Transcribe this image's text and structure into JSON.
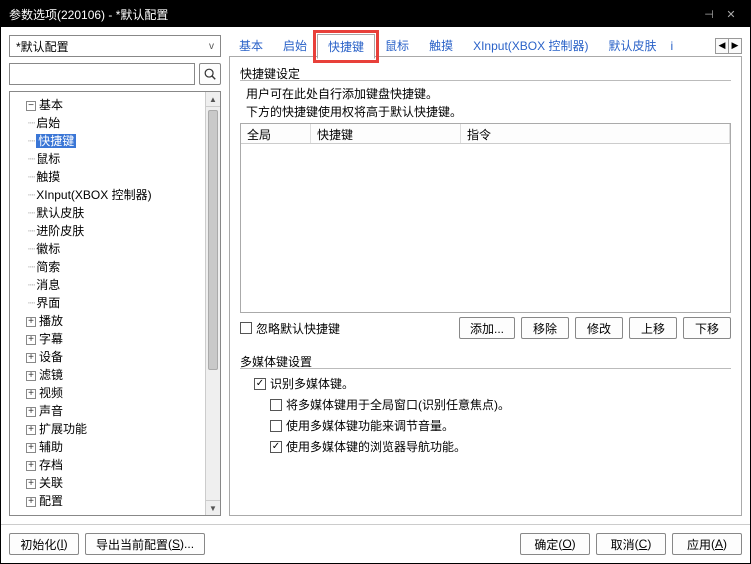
{
  "window": {
    "title": "参数选项(220106) - *默认配置"
  },
  "left": {
    "combo_value": "*默认配置"
  },
  "tree": {
    "root": "基本",
    "children": [
      "启始",
      "快捷键",
      "鼠标",
      "触摸",
      "XInput(XBOX 控制器)",
      "默认皮肤",
      "进阶皮肤",
      "徽标",
      "简索",
      "消息",
      "界面"
    ],
    "siblings": [
      "播放",
      "字幕",
      "设备",
      "滤镜",
      "视频",
      "声音",
      "扩展功能",
      "辅助",
      "存档",
      "关联",
      "配置"
    ],
    "selected": "快捷键"
  },
  "tabs": {
    "items": [
      "基本",
      "启始",
      "快捷键",
      "鼠标",
      "触摸",
      "XInput(XBOX 控制器)",
      "默认皮肤"
    ],
    "trailing": "i",
    "active": "快捷键"
  },
  "shortcut_group": {
    "title": "快捷键设定",
    "desc1": "用户可在此处自行添加键盘快捷键。",
    "desc2": "下方的快捷键使用权将高于默认快捷键。",
    "columns": {
      "c1": "全局",
      "c2": "快捷键",
      "c3": "指令"
    },
    "ignore_default": "忽略默认快捷键",
    "btn_add": "添加...",
    "btn_remove": "移除",
    "btn_edit": "修改",
    "btn_up": "上移",
    "btn_down": "下移"
  },
  "media_group": {
    "title": "多媒体键设置",
    "recognize": "识别多媒体键。",
    "global_focus": "将多媒体键用于全局窗口(识别任意焦点)。",
    "adjust_volume": "使用多媒体键功能来调节音量。",
    "browser_nav": "使用多媒体键的浏览器导航功能。",
    "states": {
      "recognize": true,
      "global_focus": false,
      "adjust_volume": false,
      "browser_nav": true
    }
  },
  "footer": {
    "init": "初始化",
    "init_k": "I",
    "export": "导出当前配置",
    "export_k": "S",
    "ok": "确定",
    "ok_k": "O",
    "cancel": "取消",
    "cancel_k": "C",
    "apply": "应用",
    "apply_k": "A"
  }
}
